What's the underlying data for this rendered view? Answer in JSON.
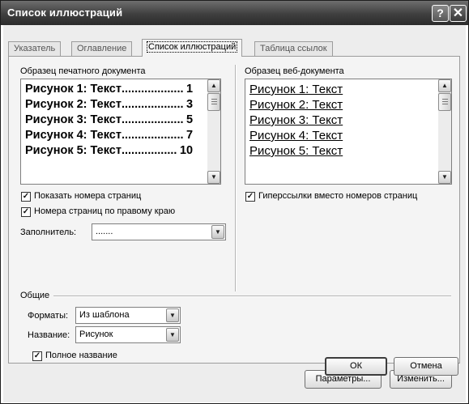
{
  "window": {
    "title": "Список иллюстраций",
    "help_glyph": "?",
    "close_glyph": "✕"
  },
  "tabs": [
    {
      "label": "Указатель"
    },
    {
      "label": "Оглавление"
    },
    {
      "label": "Список иллюстраций",
      "active": true
    },
    {
      "label": "Таблица ссылок"
    }
  ],
  "print_preview": {
    "label": "Образец печатного документа",
    "rows": [
      {
        "text": "Рисунок 1: Текст",
        "leader": "...................",
        "page": "1"
      },
      {
        "text": "Рисунок 2: Текст",
        "leader": "...................",
        "page": "3"
      },
      {
        "text": "Рисунок 3: Текст",
        "leader": "...................",
        "page": "5"
      },
      {
        "text": "Рисунок 4: Текст",
        "leader": "...................",
        "page": "7"
      },
      {
        "text": "Рисунок 5: Текст",
        "leader": ".................",
        "page": "10"
      }
    ]
  },
  "web_preview": {
    "label": "Образец веб-документа",
    "rows": [
      "Рисунок 1: Текст",
      "Рисунок 2: Текст",
      "Рисунок 3: Текст",
      "Рисунок 4: Текст",
      "Рисунок 5: Текст"
    ]
  },
  "options": {
    "show_page_numbers": {
      "label": "Показать номера страниц",
      "checked": true
    },
    "right_align": {
      "label": "Номера страниц по правому краю",
      "checked": true
    },
    "hyperlinks": {
      "label": "Гиперссылки вместо номеров страниц",
      "checked": true
    },
    "leader_label": "Заполнитель:",
    "leader_value": "......."
  },
  "general": {
    "heading": "Общие",
    "formats_label": "Форматы:",
    "formats_value": "Из шаблона",
    "caption_label": "Название:",
    "caption_value": "Рисунок",
    "full_caption": {
      "label": "Полное название",
      "checked": true
    }
  },
  "buttons": {
    "params": "Параметры...",
    "modify": "Изменить...",
    "ok": "ОК",
    "cancel": "Отмена"
  },
  "icons": {
    "scroll_up": "▲",
    "scroll_down": "▼",
    "dropdown": "▼",
    "check": "✓"
  }
}
